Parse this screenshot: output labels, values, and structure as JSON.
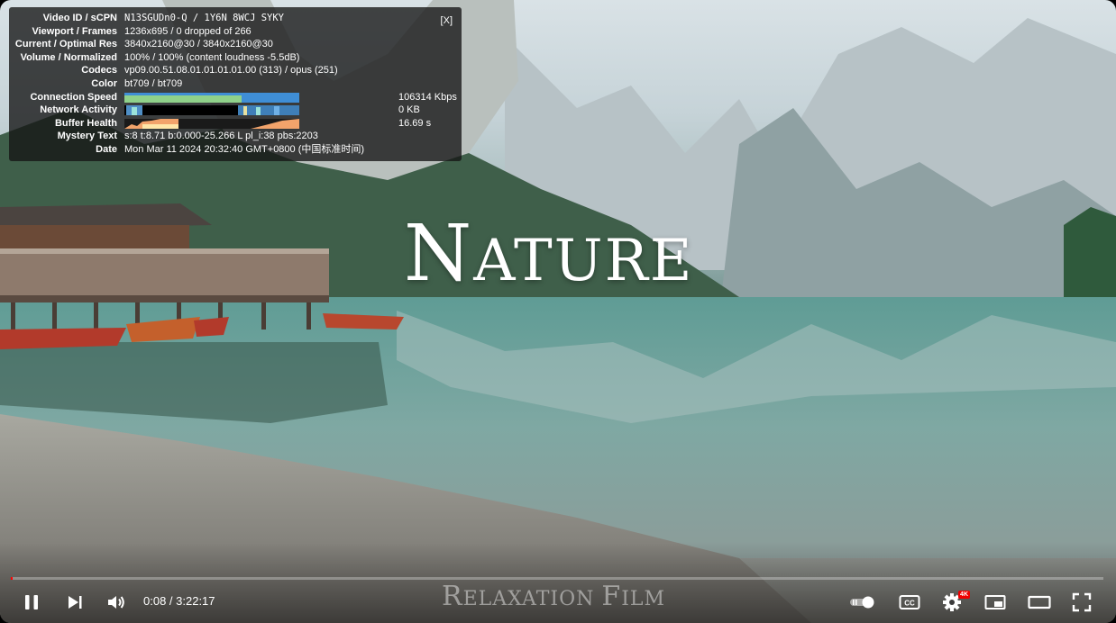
{
  "stats": {
    "close_label": "[X]",
    "rows": {
      "video_id": {
        "label": "Video ID / sCPN",
        "value": "N13SGUDn0-Q / 1Y6N 8WCJ SYKY"
      },
      "viewport": {
        "label": "Viewport / Frames",
        "value": "1236x695 / 0 dropped of 266"
      },
      "res": {
        "label": "Current / Optimal Res",
        "value": "3840x2160@30 / 3840x2160@30"
      },
      "volume": {
        "label": "Volume / Normalized",
        "value": "100% / 100% (content loudness -5.5dB)"
      },
      "codecs": {
        "label": "Codecs",
        "value": "vp09.00.51.08.01.01.01.01.00 (313) / opus (251)"
      },
      "color": {
        "label": "Color",
        "value": "bt709 / bt709"
      },
      "connection": {
        "label": "Connection Speed",
        "value": "106314 Kbps"
      },
      "network": {
        "label": "Network Activity",
        "value": "0 KB"
      },
      "buffer": {
        "label": "Buffer Health",
        "value": "16.69 s"
      },
      "mystery": {
        "label": "Mystery Text",
        "value": "s:8 t:8.71 b:0.000-25.266 L pl_i:38 pbs:2203"
      },
      "date": {
        "label": "Date",
        "value": "Mon Mar 11 2024 20:32:40 GMT+0800 (中国标准时间)"
      }
    }
  },
  "video": {
    "title_first": "N",
    "title_rest": "ATURE",
    "watermark_a": "R",
    "watermark_b": "ELAXATION ",
    "watermark_c": "F",
    "watermark_d": "ILM"
  },
  "player": {
    "current_time": "0:08",
    "duration": "3:22:17",
    "time_display": "0:08 / 3:22:17",
    "progress_fraction": 0.0007,
    "quality_badge": "4K",
    "cc_label": "CC",
    "icons": [
      "pause-icon",
      "next-icon",
      "volume-icon",
      "autoplay-toggle-icon",
      "cc-icon",
      "settings-gear-icon",
      "miniplayer-icon",
      "theater-mode-icon",
      "fullscreen-icon"
    ]
  },
  "colors": {
    "accent": "#ff0000",
    "badge": "#e00000",
    "stats_bg": "#141414"
  }
}
